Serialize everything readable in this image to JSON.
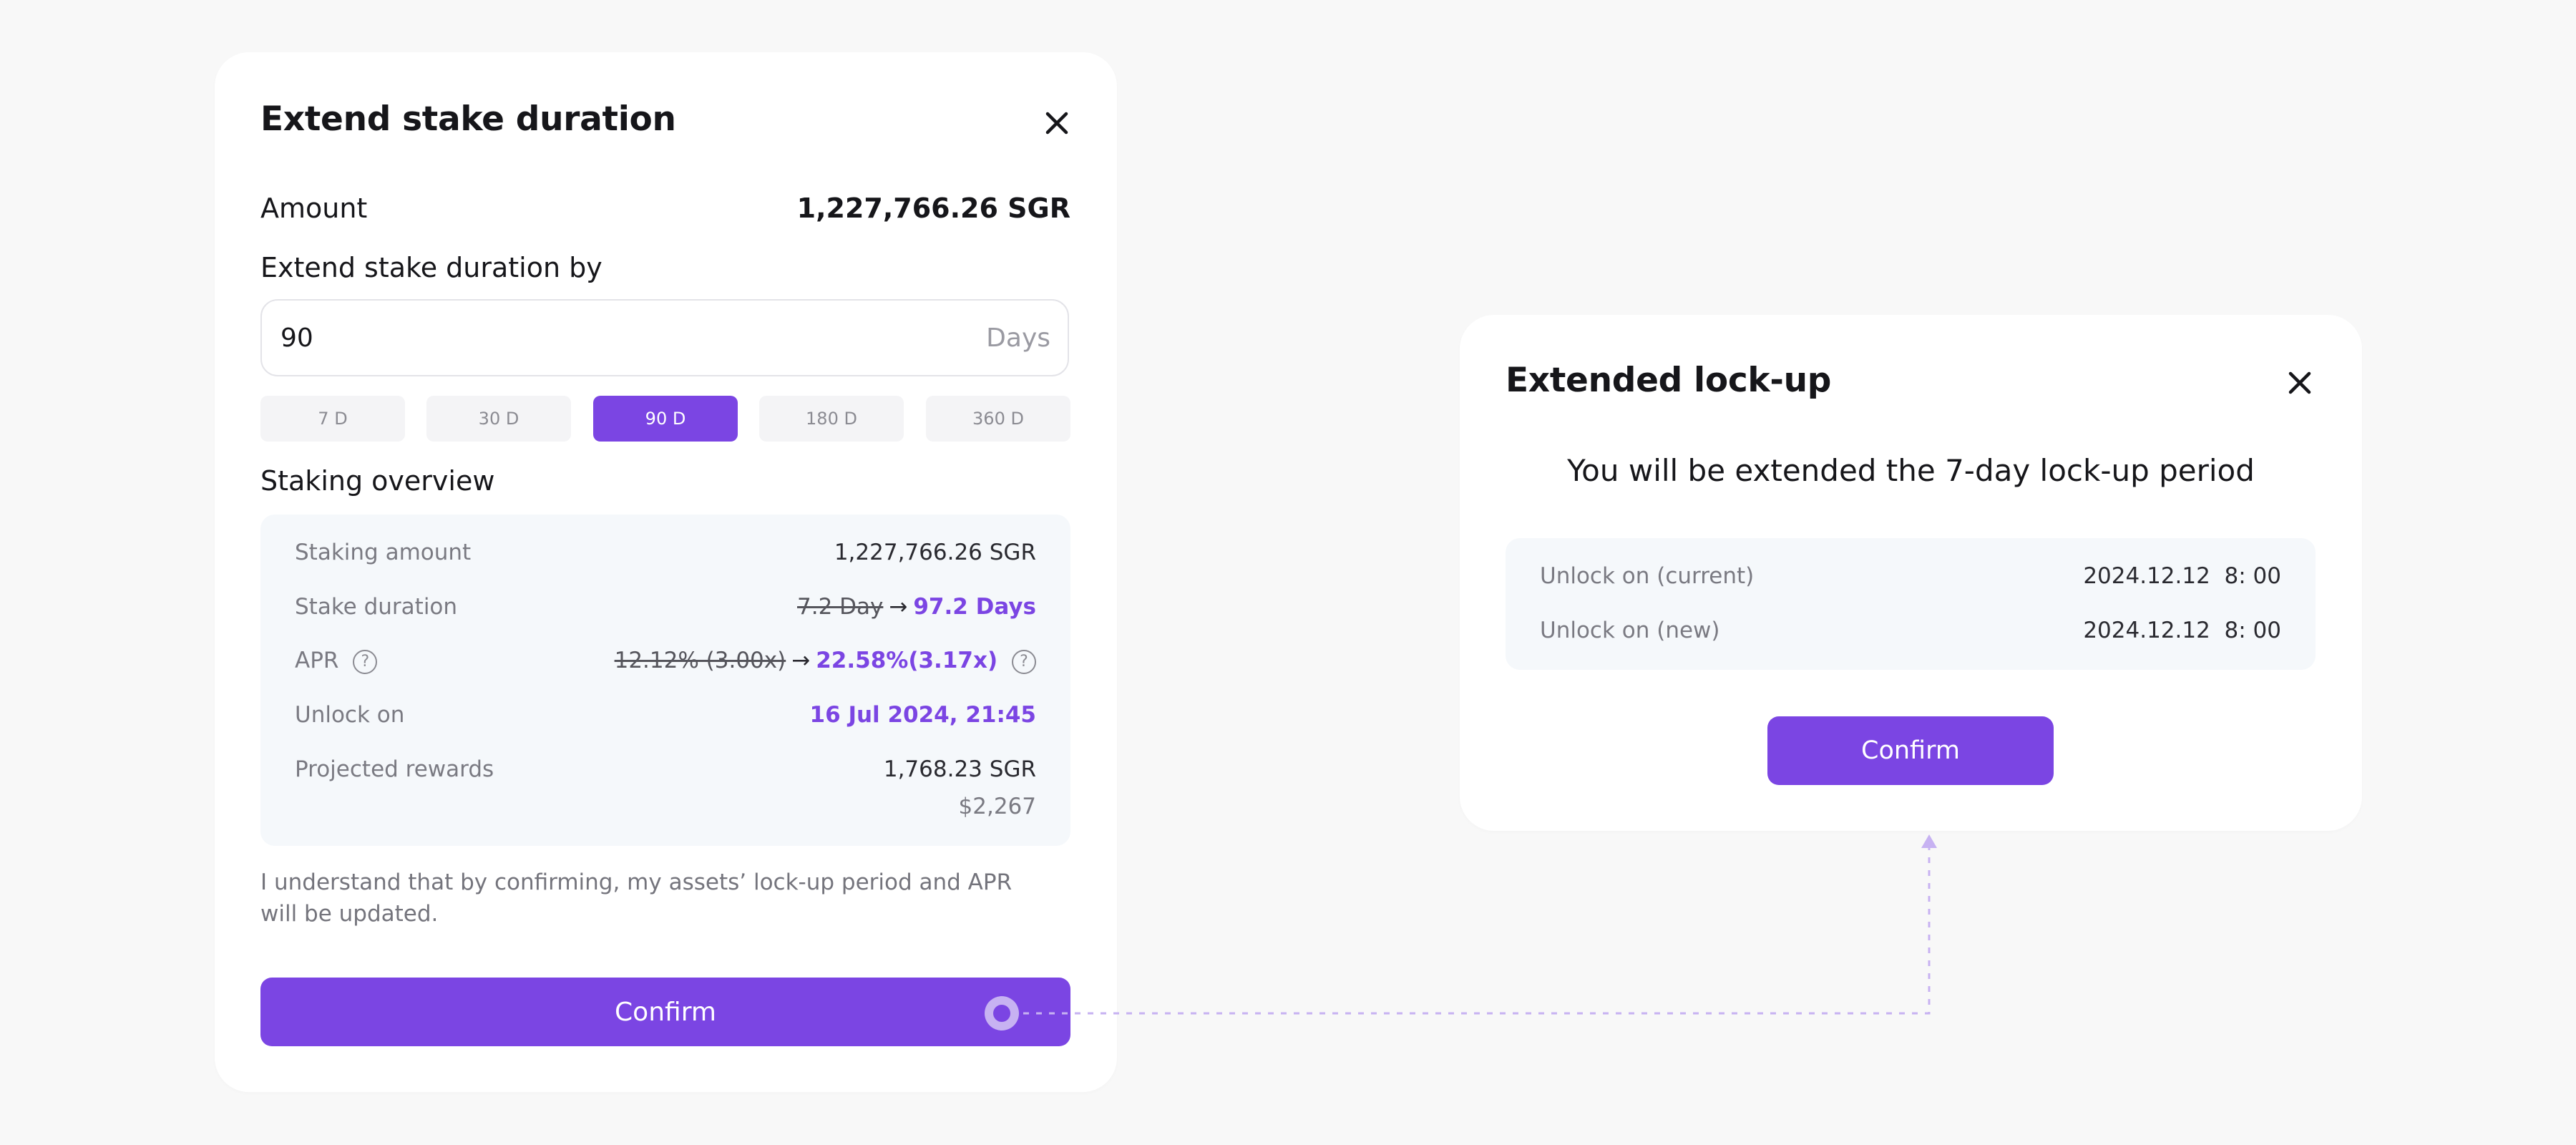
{
  "left_modal": {
    "title": "Extend stake duration",
    "amount_label": "Amount",
    "amount_value": "1,227,766.26 SGR",
    "extend_label": "Extend stake duration by",
    "input_value": "90",
    "input_unit": "Days",
    "chips": [
      {
        "label": "7 D",
        "active": false
      },
      {
        "label": "30 D",
        "active": false
      },
      {
        "label": "90 D",
        "active": true
      },
      {
        "label": "180 D",
        "active": false
      },
      {
        "label": "360 D",
        "active": false
      }
    ],
    "overview_title": "Staking overview",
    "overview": {
      "staking_amount_label": "Staking amount",
      "staking_amount_value": "1,227,766.26 SGR",
      "stake_duration_label": "Stake duration",
      "stake_duration_old": "7.2 Day",
      "stake_duration_new": "97.2 Days",
      "apr_label": "APR",
      "apr_old": "12.12% (3.00x)",
      "apr_new": "22.58%(3.17x)",
      "unlock_label": "Unlock on",
      "unlock_value": "16 Jul 2024, 21:45",
      "rewards_label": "Projected rewards",
      "rewards_value": "1,768.23 SGR",
      "rewards_usd": "$2,267"
    },
    "disclaimer": "I understand that by confirming, my assets’ lock-up period and APR will be updated.",
    "confirm_label": "Confirm"
  },
  "right_modal": {
    "title": "Extended lock-up",
    "subtitle": "You will be extended the 7-day lock-up period",
    "rows": [
      {
        "label": "Unlock on (current)",
        "value": "2024.12.12  8: 00"
      },
      {
        "label": "Unlock on (new)",
        "value": "2024.12.12  8: 00"
      }
    ],
    "confirm_label": "Confirm"
  },
  "symbols": {
    "arrow": "→",
    "question": "?"
  },
  "colors": {
    "accent": "#7b45e3",
    "connector": "#c7b2f2",
    "panel_bg": "#f5f8fb",
    "page_bg": "#f8f8f8"
  },
  "icons": [
    "close-icon",
    "question-icon",
    "arrow-right-icon"
  ]
}
